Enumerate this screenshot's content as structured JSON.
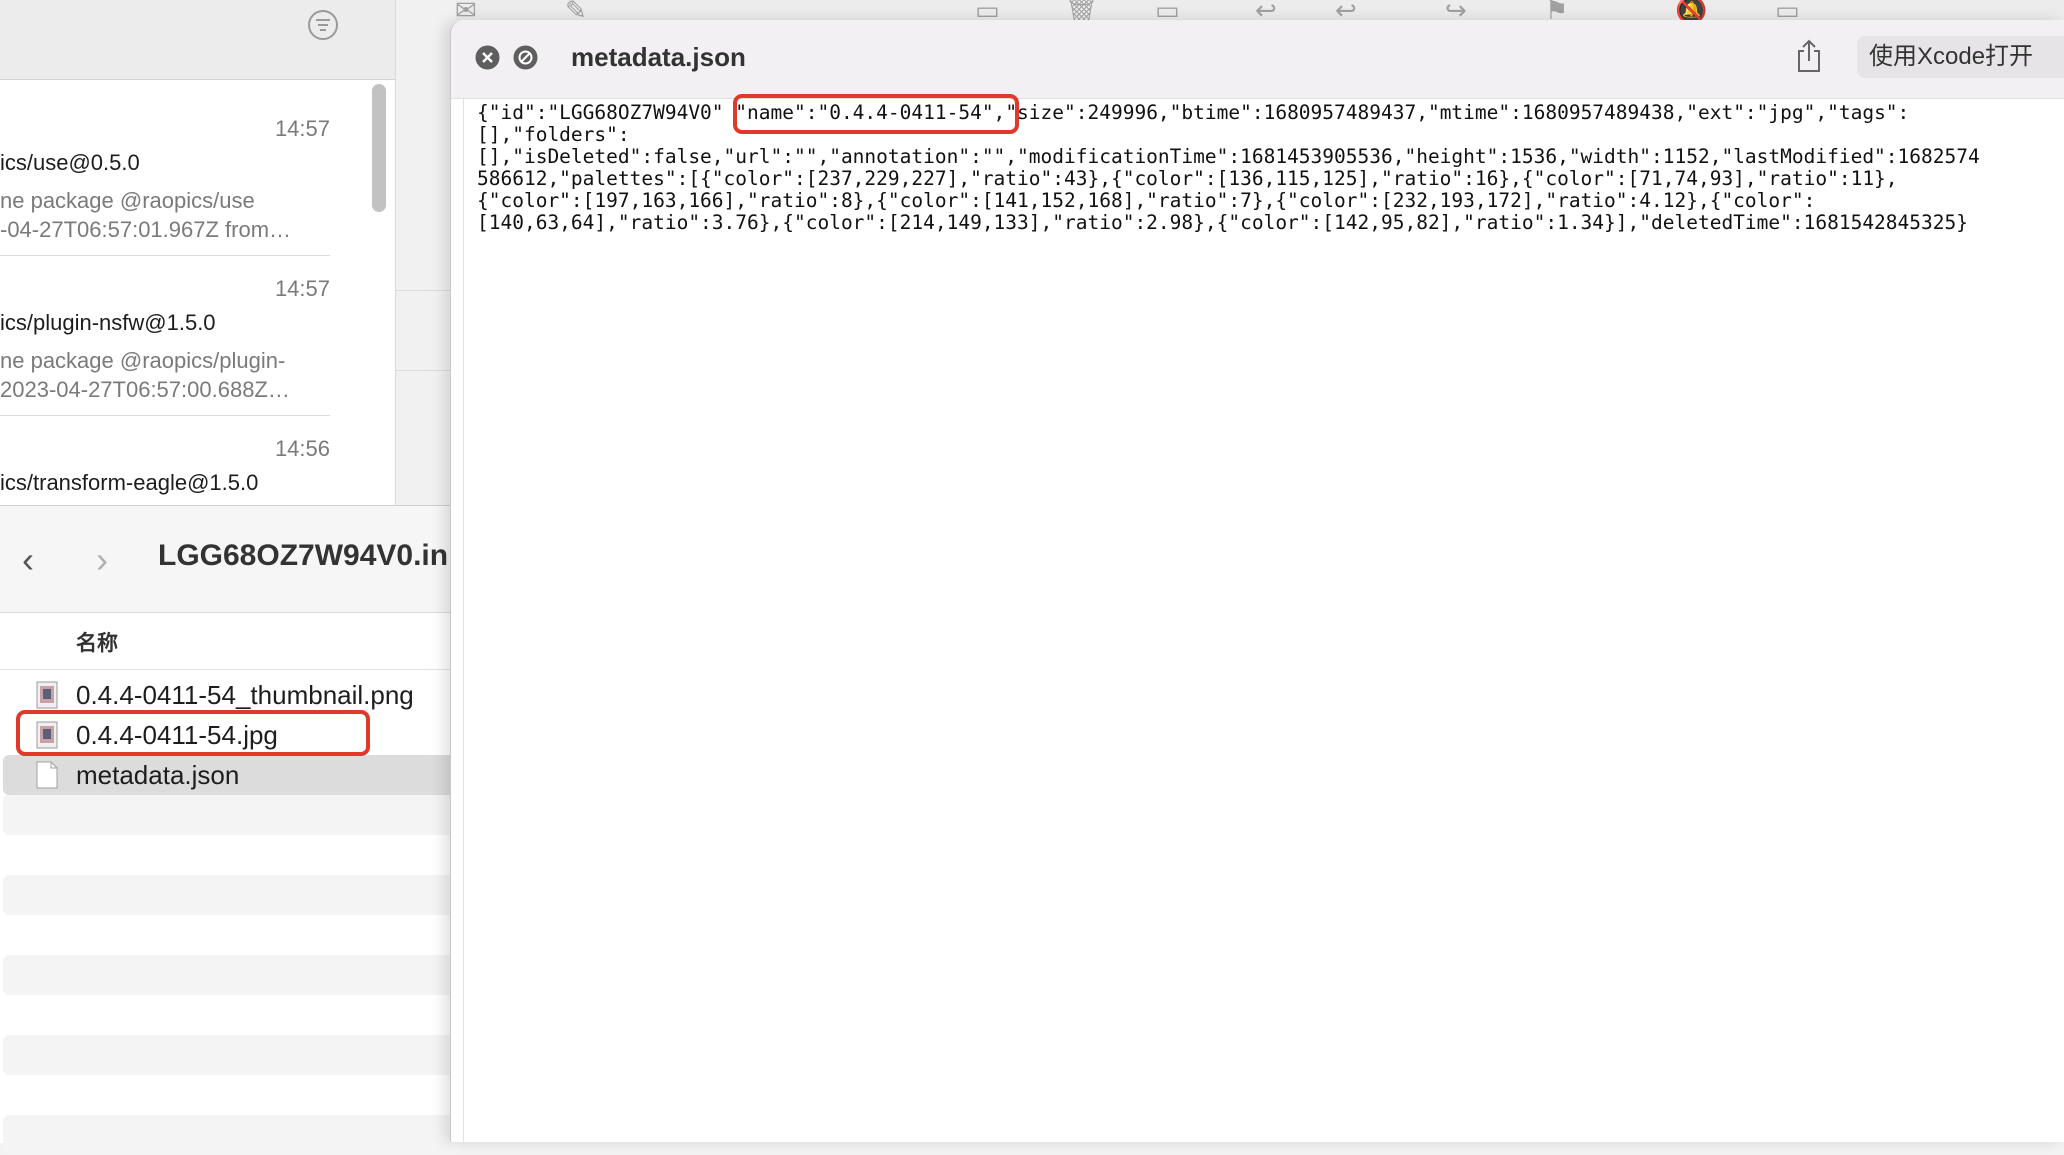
{
  "mail": {
    "messages": [
      {
        "time": "14:57",
        "sender": "ics/use@0.5.0",
        "preview1": "ne package @raopics/use",
        "preview2": "-04-27T06:57:01.967Z from…"
      },
      {
        "time": "14:57",
        "sender": "ics/plugin-nsfw@1.5.0",
        "preview1": "ne package @raopics/plugin-",
        "preview2": "2023-04-27T06:57:00.688Z…"
      },
      {
        "time": "14:56",
        "sender": "ics/transform-eagle@1.5.0",
        "preview1": "",
        "preview2": ""
      }
    ]
  },
  "finder": {
    "title": "LGG68OZ7W94V0.in",
    "column_name": "名称",
    "files": [
      {
        "name": "0.4.4-0411-54_thumbnail.png",
        "icon": "image-file-icon"
      },
      {
        "name": "0.4.4-0411-54.jpg",
        "icon": "image-file-icon"
      },
      {
        "name": "metadata.json",
        "icon": "document-file-icon"
      }
    ],
    "selected_file": "metadata.json",
    "highlighted_file": "0.4.4-0411-54.jpg"
  },
  "quicklook": {
    "title": "metadata.json",
    "open_button": "使用Xcode打开",
    "content": {
      "line1_pre": "{\"id\":\"LGG68OZ7W94V0\" ",
      "line1_hl": "\"name\":\"0.4.4-0411-54\",",
      "line1_post": "\"size\":249996,\"btime\":1680957489437,\"mtime\":1680957489438,\"ext\":\"jpg\",\"tags\":",
      "line2": "[],\"folders\":",
      "line3": "[],\"isDeleted\":false,\"url\":\"\",\"annotation\":\"\",\"modificationTime\":1681453905536,\"height\":1536,\"width\":1152,\"lastModified\":1682574",
      "line4": "586612,\"palettes\":[{\"color\":[237,229,227],\"ratio\":43},{\"color\":[136,115,125],\"ratio\":16},{\"color\":[71,74,93],\"ratio\":11},",
      "line5": "{\"color\":[197,163,166],\"ratio\":8},{\"color\":[141,152,168],\"ratio\":7},{\"color\":[232,193,172],\"ratio\":4.12},{\"color\":",
      "line6": "[140,63,64],\"ratio\":3.76},{\"color\":[214,149,133],\"ratio\":2.98},{\"color\":[142,95,82],\"ratio\":1.34}],\"deletedTime\":1681542845325}"
    }
  },
  "colors": {
    "highlight": "#e0392b",
    "selection": "#dcdcdc"
  }
}
